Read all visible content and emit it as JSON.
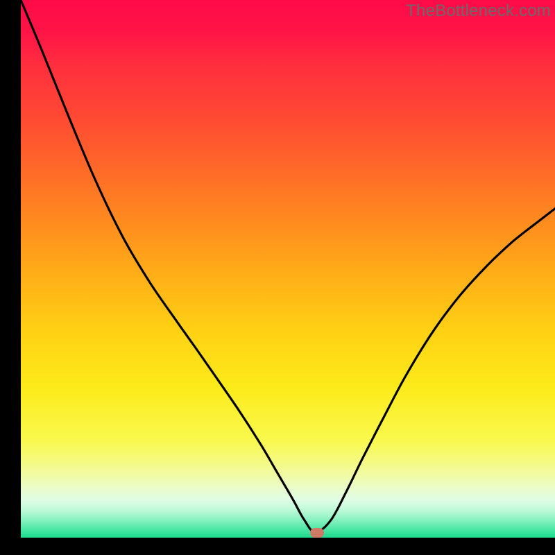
{
  "watermark": "TheBottleneck.com",
  "marker": {
    "x_frac": 0.555,
    "y_frac": 0.991
  },
  "chart_data": {
    "type": "line",
    "title": "",
    "xlabel": "",
    "ylabel": "",
    "xlim": [
      0,
      1
    ],
    "ylim": [
      0,
      1
    ],
    "series": [
      {
        "name": "bottleneck-curve",
        "x": [
          0.0,
          0.04,
          0.09,
          0.14,
          0.19,
          0.24,
          0.29,
          0.33,
          0.37,
          0.41,
          0.45,
          0.48,
          0.51,
          0.53,
          0.551,
          0.58,
          0.61,
          0.64,
          0.68,
          0.72,
          0.77,
          0.82,
          0.87,
          0.92,
          0.97,
          1.0
        ],
        "y_top": [
          1.0,
          0.905,
          0.782,
          0.664,
          0.561,
          0.477,
          0.405,
          0.349,
          0.292,
          0.234,
          0.172,
          0.121,
          0.07,
          0.034,
          0.01,
          0.032,
          0.087,
          0.148,
          0.225,
          0.3,
          0.381,
          0.448,
          0.503,
          0.55,
          0.589,
          0.612
        ]
      }
    ],
    "annotations": [
      {
        "type": "marker",
        "x": 0.555,
        "y_top": 0.009,
        "shape": "pill",
        "color": "#cf7a67"
      }
    ],
    "background_gradient": {
      "direction": "top-to-bottom",
      "stops": [
        {
          "pos": 0.0,
          "color": "#ff0b49"
        },
        {
          "pos": 0.5,
          "color": "#ffb117"
        },
        {
          "pos": 0.8,
          "color": "#f9f94e"
        },
        {
          "pos": 1.0,
          "color": "#1ddb8e"
        }
      ]
    }
  }
}
